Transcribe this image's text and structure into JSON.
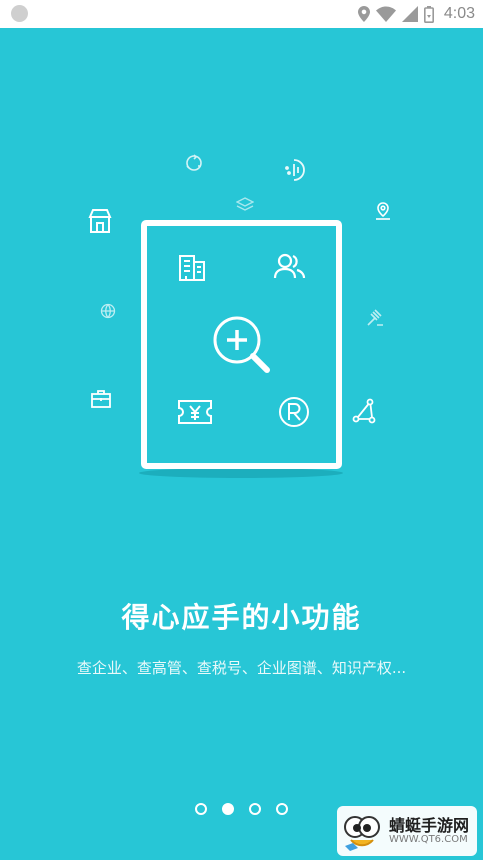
{
  "status_bar": {
    "time": "4:03",
    "icons": [
      "location-icon",
      "wifi-icon",
      "signal-icon",
      "battery-icon"
    ]
  },
  "onboarding": {
    "title": "得心应手的小功能",
    "subtitle": "查企业、查高管、查税号、企业图谱、知识产权...",
    "page_count": 4,
    "active_page": 2,
    "features": [
      "building-icon",
      "people-icon",
      "search-plus-icon",
      "yen-ticket-icon",
      "registered-icon"
    ]
  },
  "watermark": {
    "title": "蜻蜓手游网",
    "url": "WWW.QT6.COM"
  },
  "colors": {
    "background": "#27c6d6",
    "foreground": "#ffffff"
  }
}
